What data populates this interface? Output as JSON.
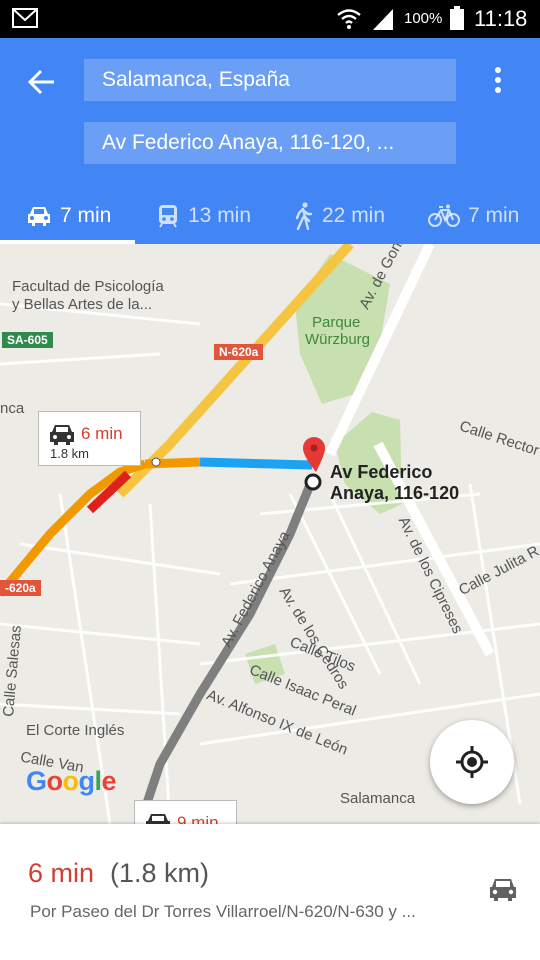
{
  "status_bar": {
    "battery_percent": "100%",
    "time": "11:18",
    "icons": [
      "mail-icon",
      "wifi-icon",
      "signal-icon",
      "battery-icon"
    ]
  },
  "header": {
    "origin": "Salamanca, España",
    "destination": "Av Federico Anaya, 116-120, ...",
    "accent_color": "#4285f4",
    "modes": [
      {
        "name": "drive",
        "label": "7 min",
        "active": true
      },
      {
        "name": "transit",
        "label": "13 min",
        "active": false
      },
      {
        "name": "walk",
        "label": "22 min",
        "active": false
      },
      {
        "name": "bike",
        "label": "7 min",
        "active": false
      }
    ]
  },
  "map": {
    "labels": {
      "facultad": "Facultad de Psicología",
      "facultad2": "y Bellas Artes de la...",
      "parque": "Parque",
      "wurzburg": "Würzburg",
      "gonzalo": "Av. de Gonzalo Torre",
      "calle_rector": "Calle Rector",
      "federico_anaya": "Av. Federico Anaya",
      "cedros": "Av. de los Cedros",
      "cipreses": "Av. de los Cipreses",
      "julita": "Calle Julita R",
      "tilos": "Calle Tilos",
      "isaac_peral": "Calle Isaac Peral",
      "alfonso": "Av. Alfonso IX de León",
      "corte_ingles": "El Corte Inglés",
      "salesas": "Calle Salesas",
      "calle_van": "Calle Van",
      "salamanca": "Salamanca",
      "nca": "nca"
    },
    "shields": {
      "sa605": "SA-605",
      "n620a": "N-620a",
      "n620a_left": "-620a"
    },
    "destination_label_line1": "Av Federico",
    "destination_label_line2": "Anaya, 116-120",
    "callout": {
      "time": "6 min",
      "distance": "1.8 km"
    },
    "callout_alt": {
      "time": "9 min"
    },
    "route_color": "#1da1f2",
    "traffic_colors": {
      "slow": "#f29900",
      "jam": "#e0201b"
    }
  },
  "sheet": {
    "eta": "6 min",
    "distance": "(1.8 km)",
    "via": "Por Paseo del Dr Torres Villarroel/N-620/N-630 y ..."
  }
}
